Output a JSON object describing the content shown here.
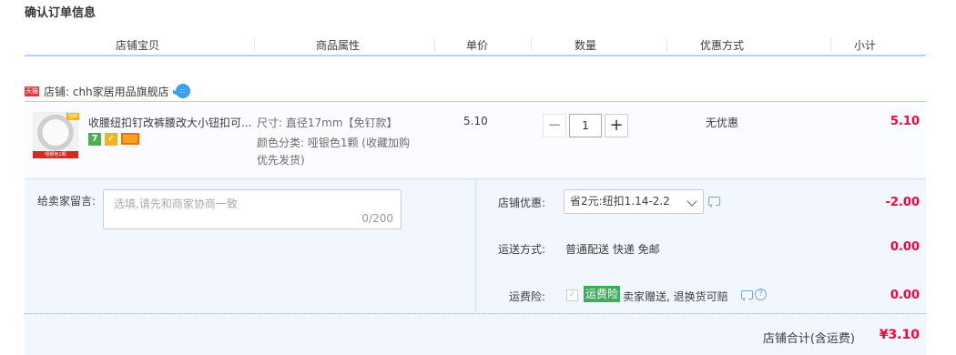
{
  "page_title": "确认订单信息",
  "columns": [
    "店铺宝贝",
    "商品属性",
    "单价",
    "数量",
    "优惠方式",
    "小计"
  ],
  "shop": {
    "badge": "天猫",
    "name": "店铺: chh家居用品旗舰店"
  },
  "item": {
    "title": "收腰纽扣钉改裤腰改大小钮扣可...",
    "thumb_label": "哑银色1颗",
    "thumb_tag": "包邮",
    "badges": [
      "7",
      "认证",
      "卡"
    ],
    "attr_size": "尺寸: 直径17mm【免钉款】",
    "attr_color_line1": "颜色分类: 哑银色1颗 (收藏加购",
    "attr_color_line2": "优先发货)",
    "price": "5.10",
    "qty_minus": "−",
    "qty": "1",
    "qty_plus": "+",
    "discount": "无优惠",
    "subtotal": "5.10"
  },
  "message": {
    "label": "给卖家留言:",
    "placeholder": "选填,请先和商家协商一致",
    "counter": "0/200"
  },
  "shop_discount": {
    "label": "店铺优惠:",
    "selected": "省2元:纽扣1.14-2.2",
    "amount": "-2.00"
  },
  "shipping": {
    "label": "运送方式:",
    "value": "普通配送 快递 免邮",
    "amount": "0.00"
  },
  "insurance": {
    "label": "运费险:",
    "tag": "运费险",
    "text": "卖家赠送, 退换货可赔",
    "amount": "0.00"
  },
  "total": {
    "label": "店铺合计(含运费)",
    "value": "¥3.10"
  },
  "colors": {
    "accent_red": "#ff0036",
    "border_blue": "#b2d1ff",
    "panel_bg": "#f2f7ff",
    "insurance_green": "#3cae5a"
  }
}
